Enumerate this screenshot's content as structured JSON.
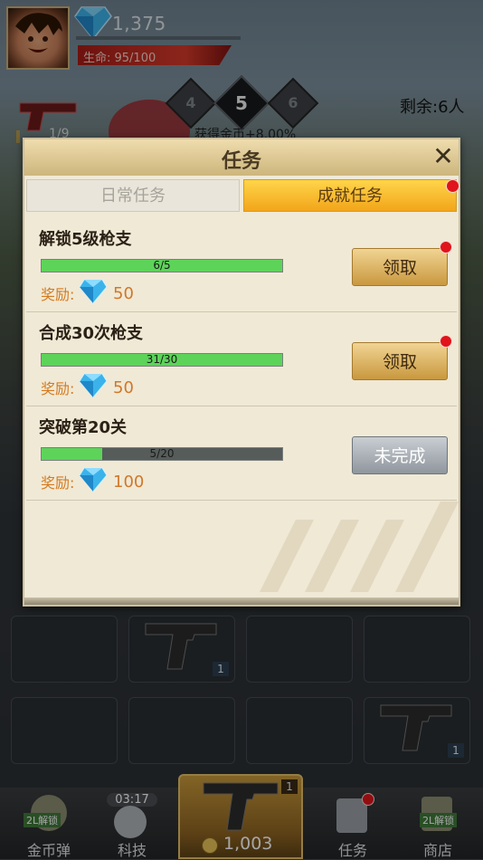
{
  "hud": {
    "gems": "1,375",
    "hp_text": "生命: 95/100",
    "stages": [
      "4",
      "5",
      "6"
    ],
    "remaining": "剩余:6人",
    "ammo_partial": "1/9",
    "reward_partial": "获得金币+8.00%"
  },
  "dialog": {
    "title": "任务",
    "close_icon": "close-icon",
    "tabs": [
      {
        "label": "日常任务",
        "active": false
      },
      {
        "label": "成就任务",
        "active": true
      }
    ],
    "reward_label": "奖励:",
    "tasks": [
      {
        "name": "解锁5级枪支",
        "progress_text": "6/5",
        "progress": 1.0,
        "reward": "50",
        "button": "领取",
        "completed": true
      },
      {
        "name": "合成30次枪支",
        "progress_text": "31/30",
        "progress": 1.0,
        "reward": "50",
        "button": "领取",
        "completed": true
      },
      {
        "name": "突破第20关",
        "progress_text": "5/20",
        "progress": 0.25,
        "reward": "100",
        "button": "未完成",
        "completed": false
      }
    ]
  },
  "grid": {
    "slot_qty": [
      "1",
      "1"
    ]
  },
  "nav": {
    "items": [
      {
        "label": "金币弹",
        "badge": "2L解锁"
      },
      {
        "label": "科技",
        "timer": "03:17"
      },
      {
        "label": "任务"
      },
      {
        "label": "商店",
        "badge": "2L解锁"
      }
    ],
    "center_coins": "1,003",
    "center_qty": "1"
  },
  "colors": {
    "accent_gold": "#f2a51a",
    "progress_green": "#5dd35a",
    "alert_red": "#e0141a",
    "reward_orange": "#d47a1e"
  }
}
